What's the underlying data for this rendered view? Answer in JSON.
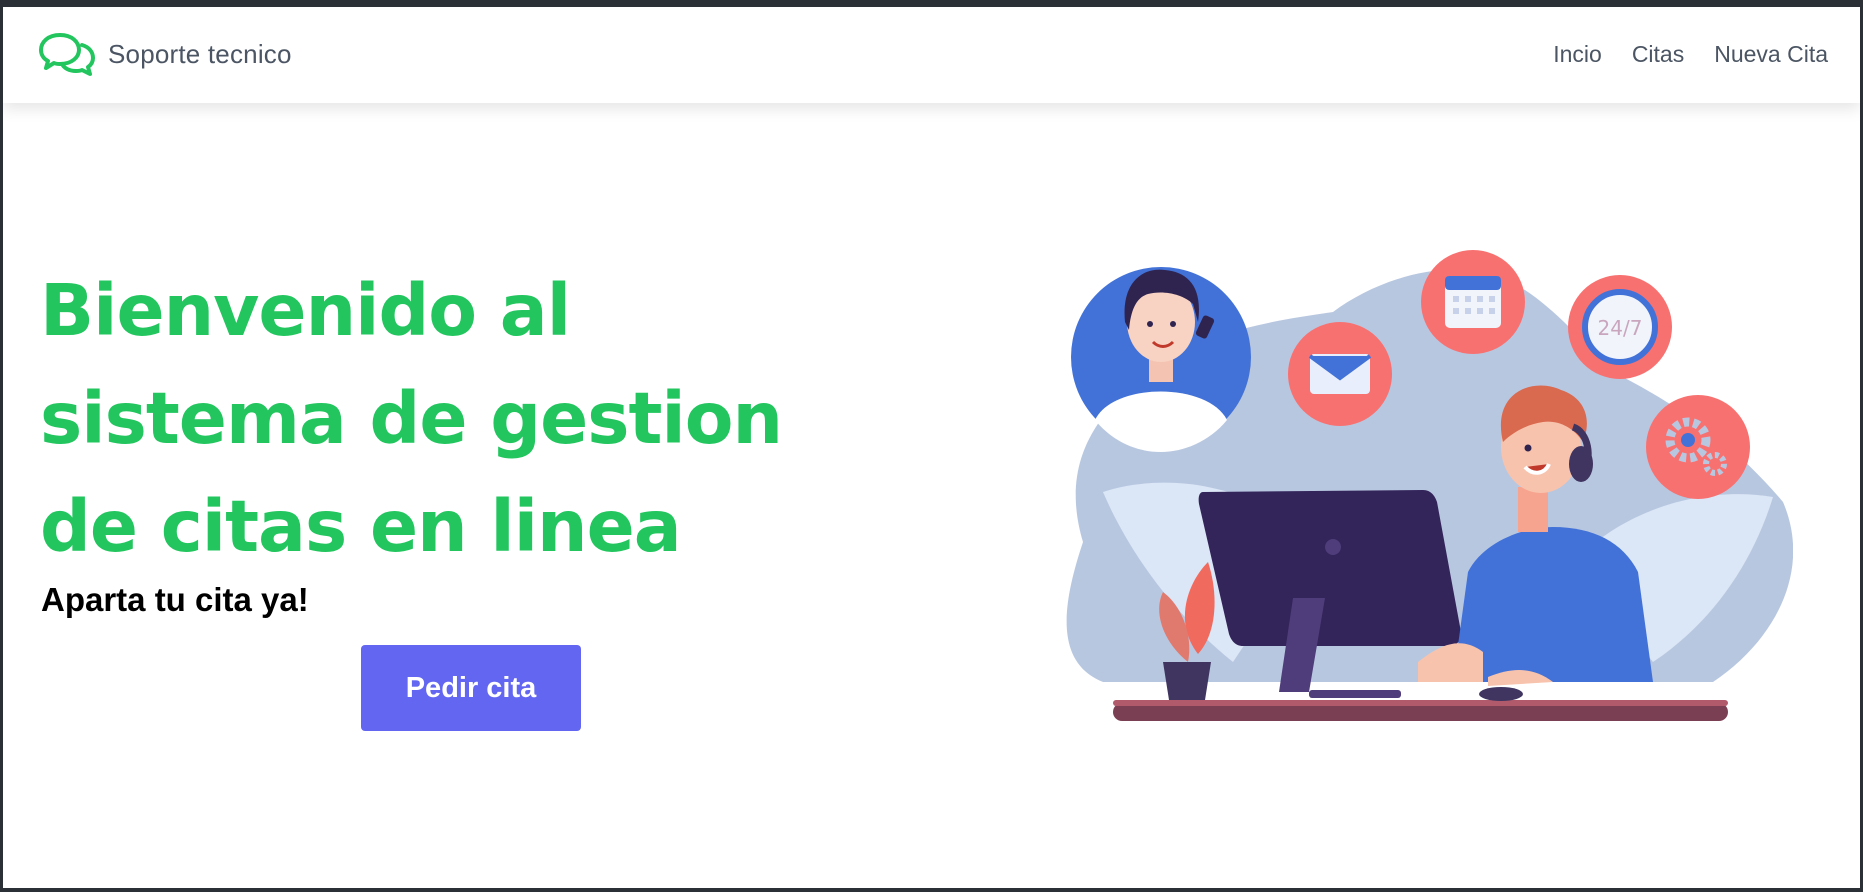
{
  "navbar": {
    "brand": "Soporte tecnico",
    "links": [
      "Incio",
      "Citas",
      "Nueva Cita"
    ]
  },
  "hero": {
    "title": "Bienvenido al sistema de gestion de citas en linea",
    "subtitle": "Aparta tu cita ya!",
    "cta_label": "Pedir cita"
  },
  "illustration": {
    "badge_24_7": "24/7",
    "icons": [
      "chat-bubbles-icon",
      "email-icon",
      "calendar-icon",
      "clock-24-7-icon",
      "gears-icon"
    ]
  },
  "colors": {
    "accent_green": "#22c55e",
    "button_indigo": "#6366f1",
    "nav_text": "#4b5563",
    "coral": "#f87171"
  }
}
